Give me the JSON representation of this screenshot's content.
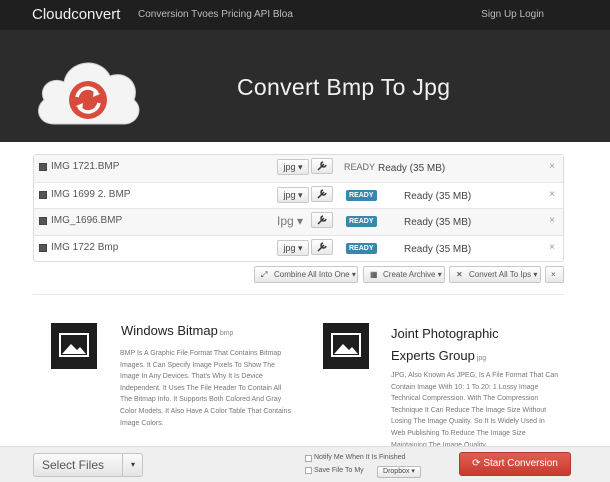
{
  "navbar": {
    "brand": "Cloudconvert",
    "links": "Conversion Tvoes Pricing API Bloa",
    "right": "Sign Up Login"
  },
  "hero": {
    "title": "Convert Bmp To Jpg"
  },
  "files": [
    {
      "name": "IMG 1721.BMP",
      "format": "jpg ▾",
      "badge": "READY",
      "status": "Ready (35 MB)",
      "remove": "×"
    },
    {
      "name": "IMG 1699 2. BMP",
      "format": "jpg ▾",
      "badge": "READY",
      "status": "Ready (35 MB)",
      "remove": "×"
    },
    {
      "name": "IMG_1696.BMP",
      "format": "Ipg ▾",
      "badge": "READY",
      "status": "Ready (35 MB)",
      "remove": "×"
    },
    {
      "name": "IMG 1722 Bmp",
      "format": "jpg ▾",
      "badge": "READY",
      "status": "Ready (35 MB)",
      "remove": "×"
    }
  ],
  "toolbar": {
    "combine": "Combine All Into One ▾",
    "archive": "Create Archive ▾",
    "convert_all": "Convert All To Ips ▾",
    "close": "×"
  },
  "info": [
    {
      "title": "Windows Bitmap",
      "ext": "bmp",
      "text": "BMP Is A Graphic File Format That Contains Bitmap Images. It Can Specify Image Pixels To Show The Image In Any Devices. That's Why It Is Device Independent. It Uses The File Header To Contain All The Bitmap Info. It Supports Both Colored And Gray Color Models. It Also Have A Color Table That Contains Image Colors."
    },
    {
      "title": "Joint Photographic Experts Group",
      "ext": "jpg",
      "text": "JPG, Also Known As JPEG, Is A File Format That Can Contain Image With 10: 1 To 20: 1 Lossy Image Technical Compression. With The Compression Technique It Can Reduce The Image Size Without Losing The Image Quality. So It Is Widely Used In Web Publishing To Reduce The Image Size Maintaining The Image Quality."
    }
  ],
  "footer": {
    "select_files": "Select Files",
    "select_caret": "▾",
    "notify": "Notify Me When It Is Finished",
    "save_to": "Save File To My",
    "dropbox": "Dropbox ▾",
    "start": "Start Conversion"
  }
}
